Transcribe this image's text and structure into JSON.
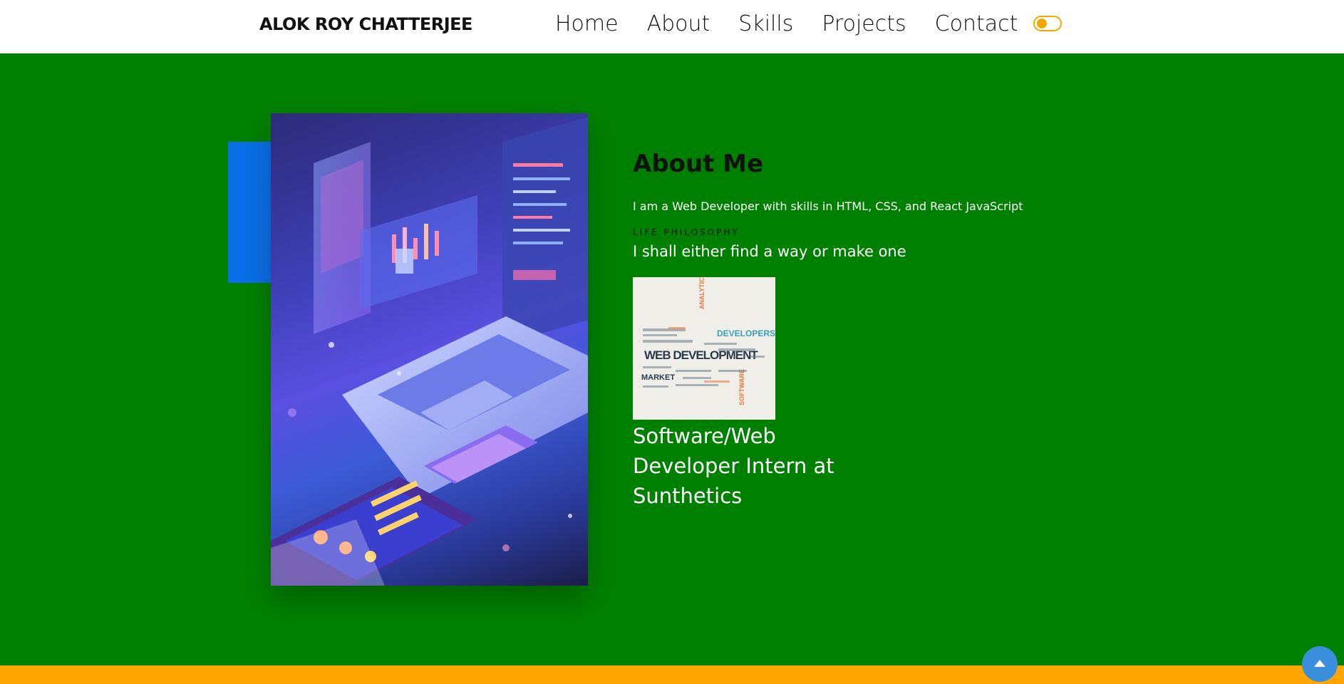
{
  "header": {
    "brand": "ALOK ROY CHATTERJEE",
    "nav": [
      "Home",
      "About",
      "Skills",
      "Projects",
      "Contact"
    ],
    "theme_toggle_icon": "toggle-switch-icon"
  },
  "about": {
    "title": "About Me",
    "description": "I am a Web Developer with skills in HTML, CSS, and React JavaScript",
    "philosophy_label": "LIFE PHILOSOPHY",
    "philosophy_quote": "I shall either find a way or make one",
    "image_text": {
      "main": "WEB DEVELOPMENT",
      "developers": "DEVELOPERS",
      "analytics": "ANALYTICS",
      "software": "SOFTWARE",
      "market": "MARKET"
    },
    "job_title": "Software/Web Developer Intern at Sunthetics"
  },
  "scroll_top_icon": "arrow-up-icon",
  "colors": {
    "background": "#008000",
    "accent_block": "#0a6fe8",
    "footer": "#ffa500",
    "toggle": "#f0a800",
    "scroll_button": "#3a8fdc"
  }
}
